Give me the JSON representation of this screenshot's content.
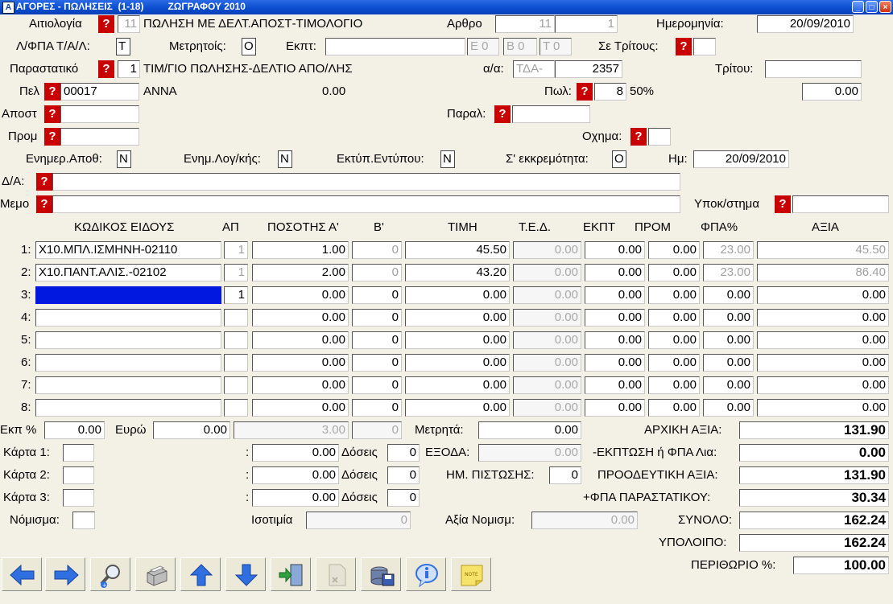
{
  "window": {
    "app_icon": "A",
    "title": "ΑΓΟΡΕΣ - ΠΩΛΗΣΕΙΣ  (1-18)         ΖΩΓΡΑΦΟΥ 2010"
  },
  "header": {
    "aitiologia_label": "Αιτιολογία",
    "aitiologia_code": "11",
    "aitiologia_desc": "ΠΩΛΗΣΗ ΜΕ ΔΕΛΤ.ΑΠΟΣΤ-ΤΙΜΟΛΟΓΙΟ",
    "arthro_label": "Αρθρο",
    "arthro_1": "11",
    "arthro_2": "1",
    "date_label": "Ημερομηνία:",
    "date_value": "20/09/2010",
    "fpa_label": "Λ/ΦΠΑ Τ/Α/Λ:",
    "fpa_value": "Τ",
    "metritois_label": "Μετρητοίς:",
    "metritois_value": "Ο",
    "ekpt_label": "Εκπτ:",
    "ekpt_value": "",
    "e_value": "Ε 0",
    "b_value": "Β 0",
    "t_value": "Τ 0",
    "tritous_label": "Σε Τρίτους:",
    "tritous_value": "",
    "parastatiko_label": "Παραστατικό",
    "parastatiko_code": "1",
    "parastatiko_desc": "ΤΙΜ/ΓΙΟ ΠΩΛΗΣΗΣ-ΔΕΛΤΙΟ ΑΠΟ/ΛΗΣ",
    "aa_label": "α/α:",
    "aa_series": "ΤΔΑ-",
    "aa_number": "2357",
    "tritou_label": "Τρίτου:",
    "tritou_value": "",
    "pel_label": "Πελ",
    "pel_code": "00017",
    "pel_name": "ΑΝΝΑ",
    "pel_balance": "0.00",
    "pol_label": "Πωλ:",
    "pol_code": "8",
    "pol_percent": "50%",
    "pol_value": "0.00",
    "apost_label": "Αποστ",
    "apost_value": "",
    "paral_label": "Παραλ:",
    "paral_value": "",
    "prom_label": "Προμ",
    "prom_value": "",
    "oxima_label": "Οχημα:",
    "oxima_value": "",
    "enimer_apoth_label": "Ενημερ.Αποθ:",
    "enimer_apoth_value": "Ν",
    "enim_log_label": "Ενημ.Λογ/κής:",
    "enim_log_value": "Ν",
    "ektyp_label": "Εκτύπ.Εντύπου:",
    "ektyp_value": "Ν",
    "ekkrem_label": "Σ' εκκρεμότητα:",
    "ekkrem_value": "Ο",
    "im_label": "Ημ:",
    "im_value": "20/09/2010",
    "da_label": "Δ/Α:",
    "da_value": "",
    "memo_label": "Μεμο",
    "memo_value": "",
    "ypokatastima_label": "Υποκ/στημα",
    "ypokatastima_value": ""
  },
  "table": {
    "headers": [
      "ΚΩΔΙΚΟΣ ΕΙΔΟΥΣ",
      "ΑΠ",
      "ΠΟΣΟΤΗΣ Α'",
      "Β'",
      "ΤΙΜΗ",
      "Τ.Ε.Δ.",
      "ΕΚΠΤ",
      "ΠΡΟΜ",
      "ΦΠΑ%",
      "ΑΞΙΑ"
    ],
    "rows": [
      {
        "num": "1:",
        "code": "Χ10.ΜΠΛ.ΙΣΜΗΝΗ-02110",
        "ap": "1",
        "qty_a": "1.00",
        "qty_b": "0",
        "price": "45.50",
        "ted": "0.00",
        "ekpt": "0.00",
        "prom": "0.00",
        "fpa": "23.00",
        "axia": "45.50"
      },
      {
        "num": "2:",
        "code": "Χ10.ΠΑΝΤ.ΑΛΙΣ.-02102",
        "ap": "1",
        "qty_a": "2.00",
        "qty_b": "0",
        "price": "43.20",
        "ted": "0.00",
        "ekpt": "0.00",
        "prom": "0.00",
        "fpa": "23.00",
        "axia": "86.40"
      },
      {
        "num": "3:",
        "code": "",
        "ap": "1",
        "qty_a": "0.00",
        "qty_b": "0",
        "price": "0.00",
        "ted": "0.00",
        "ekpt": "0.00",
        "prom": "0.00",
        "fpa": "0.00",
        "axia": "0.00"
      },
      {
        "num": "4:",
        "code": "",
        "ap": "",
        "qty_a": "0.00",
        "qty_b": "0",
        "price": "0.00",
        "ted": "0.00",
        "ekpt": "0.00",
        "prom": "0.00",
        "fpa": "0.00",
        "axia": "0.00"
      },
      {
        "num": "5:",
        "code": "",
        "ap": "",
        "qty_a": "0.00",
        "qty_b": "0",
        "price": "0.00",
        "ted": "0.00",
        "ekpt": "0.00",
        "prom": "0.00",
        "fpa": "0.00",
        "axia": "0.00"
      },
      {
        "num": "6:",
        "code": "",
        "ap": "",
        "qty_a": "0.00",
        "qty_b": "0",
        "price": "0.00",
        "ted": "0.00",
        "ekpt": "0.00",
        "prom": "0.00",
        "fpa": "0.00",
        "axia": "0.00"
      },
      {
        "num": "7:",
        "code": "",
        "ap": "",
        "qty_a": "0.00",
        "qty_b": "0",
        "price": "0.00",
        "ted": "0.00",
        "ekpt": "0.00",
        "prom": "0.00",
        "fpa": "0.00",
        "axia": "0.00"
      },
      {
        "num": "8:",
        "code": "",
        "ap": "",
        "qty_a": "0.00",
        "qty_b": "0",
        "price": "0.00",
        "ted": "0.00",
        "ekpt": "0.00",
        "prom": "0.00",
        "fpa": "0.00",
        "axia": "0.00"
      }
    ]
  },
  "footer": {
    "ekp_label": "Εκπ %",
    "ekp_value": "0.00",
    "evro_label": "Ευρώ",
    "evro_value": "0.00",
    "mid_value": "3.00",
    "mid_value2": "0",
    "metrita_label": "Μετρητά:",
    "metrita_value": "0.00",
    "arxiki_label": "ΑΡΧΙΚΗ ΑΞΙΑ:",
    "arxiki_value": "131.90",
    "karta1_label": "Κάρτα 1:",
    "karta1_value": "",
    "karta1_amount": "0.00",
    "karta2_label": "Κάρτα 2:",
    "karta2_value": "",
    "karta2_amount": "0.00",
    "karta3_label": "Κάρτα 3:",
    "karta3_value": "",
    "karta3_amount": "0.00",
    "colon": ":",
    "doseis_label": "Δόσεις",
    "doseis1": "0",
    "doseis2": "0",
    "doseis3": "0",
    "eksoda_label": "ΕΞΟΔΑ:",
    "eksoda_value": "0.00",
    "ekptosi_label": "-ΕΚΠΤΩΣΗ ή ΦΠΑ Λια:",
    "ekptosi_value": "0.00",
    "im_pistosis_label": "ΗΜ. ΠΙΣΤΩΣΗΣ:",
    "im_pistosis_value": "0",
    "proodeftiki_label": "ΠΡΟΟΔΕΥΤΙΚΗ ΑΞΙΑ:",
    "proodeftiki_value": "131.90",
    "fpa_par_label": "+ΦΠΑ ΠΑΡΑΣΤΑΤΙΚΟΥ:",
    "fpa_par_value": "30.34",
    "nomisma_label": "Νόμισμα:",
    "nomisma_value": "",
    "isotimia_label": "Ισοτιμία",
    "isotimia_value": "0",
    "axia_nom_label": "Αξία Νομισμ:",
    "axia_nom_value": "0.00",
    "synolo_label": "ΣΥΝΟΛΟ:",
    "synolo_value": "162.24",
    "ypoloipo_label": "ΥΠΟΛΟΙΠΟ:",
    "ypoloipo_value": "162.24",
    "periothorio_label": "ΠΕΡΙΘΩΡΙΟ %:",
    "periothorio_value": "100.00"
  },
  "toolbar": {
    "icons": [
      "arrow-left-icon",
      "arrow-right-icon",
      "search-icon",
      "printer-icon",
      "arrow-up-icon",
      "arrow-down-icon",
      "exit-door-icon",
      "delete-icon",
      "save-icon",
      "info-icon",
      "note-icon"
    ]
  },
  "colors": {
    "question_red": "#c80000",
    "selection_blue": "#0018e0",
    "titlebar_blue": "#0a4ccd",
    "toolbar_arrow": "#2f6fe0"
  }
}
